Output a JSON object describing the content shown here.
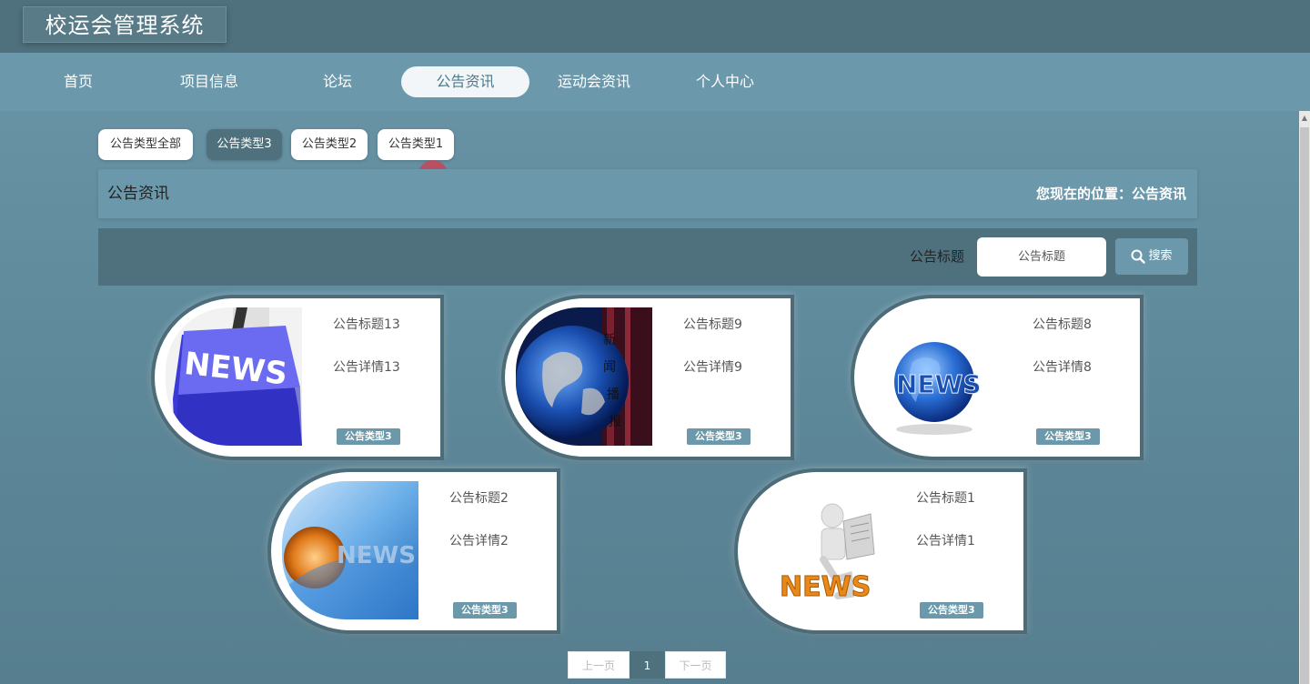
{
  "app": {
    "title": "校运会管理系统"
  },
  "nav": {
    "items": [
      {
        "label": "首页"
      },
      {
        "label": "项目信息"
      },
      {
        "label": "论坛"
      },
      {
        "label": "公告资讯",
        "active": true
      },
      {
        "label": "运动会资讯"
      },
      {
        "label": "个人中心"
      }
    ]
  },
  "type_filters": [
    {
      "label": "公告类型全部"
    },
    {
      "label": "公告类型3",
      "active": true
    },
    {
      "label": "公告类型2"
    },
    {
      "label": "公告类型1"
    }
  ],
  "breadcrumb": {
    "title": "公告资讯",
    "location": "您现在的位置：公告资讯"
  },
  "search": {
    "label": "公告标题",
    "placeholder": "公告标题",
    "button_label": "搜索"
  },
  "cards": [
    {
      "title": "公告标题13",
      "detail": "公告详情13",
      "badge": "公告类型3",
      "image": "news-keyboard-image"
    },
    {
      "title": "公告标题9",
      "detail": "公告详情9",
      "badge": "公告类型3",
      "image": "news-globe-broadcast-image"
    },
    {
      "title": "公告标题8",
      "detail": "公告详情8",
      "badge": "公告类型3",
      "image": "news-globe-logo-image"
    },
    {
      "title": "公告标题2",
      "detail": "公告详情2",
      "badge": "公告类型3",
      "image": "news-blue-abstract-image"
    },
    {
      "title": "公告标题1",
      "detail": "公告详情1",
      "badge": "公告类型3",
      "image": "news-reader-figure-image"
    }
  ],
  "pagination": {
    "prev_label": "上一页",
    "current": "1",
    "next_label": "下一页"
  },
  "colors": {
    "header": "#4f717d",
    "nav": "#6b98aa",
    "accent": "#6b98aa",
    "background": "#6a96a8"
  }
}
